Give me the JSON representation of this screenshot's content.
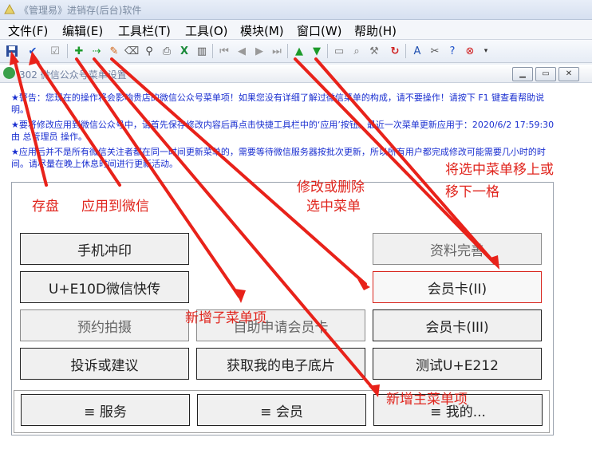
{
  "window": {
    "title": "《管理易》进销存(后台)软件"
  },
  "menu": [
    {
      "label": "文件(F)"
    },
    {
      "label": "编辑(E)"
    },
    {
      "label": "工具栏(T)"
    },
    {
      "label": "工具(O)"
    },
    {
      "label": "模块(M)"
    },
    {
      "label": "窗口(W)"
    },
    {
      "label": "帮助(H)"
    }
  ],
  "child": {
    "title": "302 微信公众号菜单设置"
  },
  "notices": [
    "★警告：您现在的操作将会影响贵店的微信公众号菜单项！如果您没有详细了解过微信菜单的构成，请不要操作！请按下 F1 键查看帮助说明。",
    "★要将修改应用到微信公众号中，请首先保存修改内容后再点击快捷工具栏中的‘应用’按钮。最近一次菜单更新应用于：2020/6/2 17:59:30 由 总管理员 操作。",
    "★应用后并不是所有微信关注者都在同一时间更新菜单的，需要等待微信服务器按批次更新，所以所有用户都完成修改可能需要几小时的时间。请尽量在晚上休息时间进行更新活动。"
  ],
  "buttons": {
    "b1": "手机冲印",
    "b2": "资料完善",
    "b3": "U+E10D微信快传",
    "b4": "会员卡(II)",
    "b5": "预约拍摄",
    "b6": "自助申请会员卡",
    "b7": "会员卡(III)",
    "b8": "投诉或建议",
    "b9": "获取我的电子底片",
    "b10": "测试U+E212",
    "m1": "≡ 服务",
    "m2": "≡ 会员",
    "m3": "≡ 我的..."
  },
  "annotations": {
    "save": "存盘",
    "apply": "应用到微信",
    "modify1": "修改或删除",
    "modify2": "选中菜单",
    "move1": "将选中菜单移上或",
    "move2": "移下一格",
    "add_sub": "新增子菜单项",
    "add_main": "新增主菜单项"
  }
}
